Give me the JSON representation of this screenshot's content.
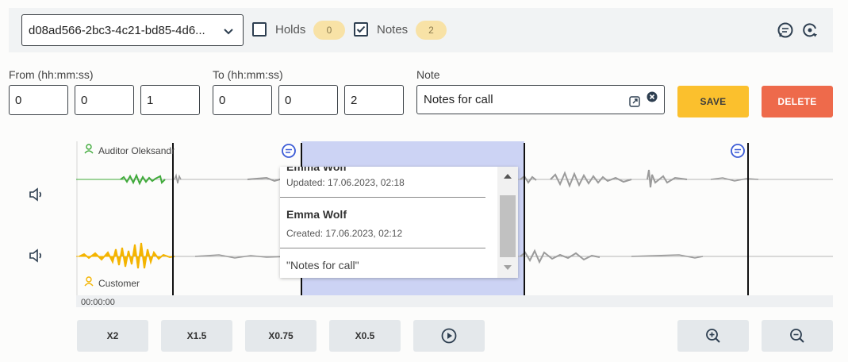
{
  "toolbar": {
    "call_id": "d08ad566-2bc3-4c21-bd85-4d6...",
    "holds_label": "Holds",
    "holds_count": "0",
    "holds_checked": false,
    "notes_label": "Notes",
    "notes_count": "2",
    "notes_checked": true
  },
  "form": {
    "from_label": "From (hh:mm:ss)",
    "from_h": "0",
    "from_m": "0",
    "from_s": "1",
    "to_label": "To (hh:mm:ss)",
    "to_h": "0",
    "to_m": "0",
    "to_s": "2",
    "note_label": "Note",
    "note_value": "Notes for call",
    "save_label": "SAVE",
    "delete_label": "DELETE"
  },
  "waveform": {
    "agent_label": "Auditor Oleksandr",
    "customer_label": "Customer",
    "time_start": "00:00:00",
    "colors": {
      "agent": "#3faa3a",
      "customer": "#f4b400",
      "selection": "#ccd3f4",
      "wave_gray": "#9a9a9a"
    }
  },
  "note_popup": {
    "prev_author": "Emma Wolf",
    "updated": "Updated: 17.06.2023, 02:18",
    "author": "Emma Wolf",
    "created": "Created: 17.06.2023, 02:12",
    "text": "\"Notes for call\""
  },
  "playback": {
    "speed_x2": "X2",
    "speed_x15": "X1.5",
    "speed_x075": "X0.75",
    "speed_x05": "X0.5"
  },
  "icons": [
    "chevron-down-icon",
    "check-icon",
    "comment-icon",
    "sync-icon",
    "expand-icon",
    "clear-icon",
    "speaker-icon",
    "user-icon",
    "play-icon",
    "zoom-in-icon",
    "zoom-out-icon"
  ]
}
